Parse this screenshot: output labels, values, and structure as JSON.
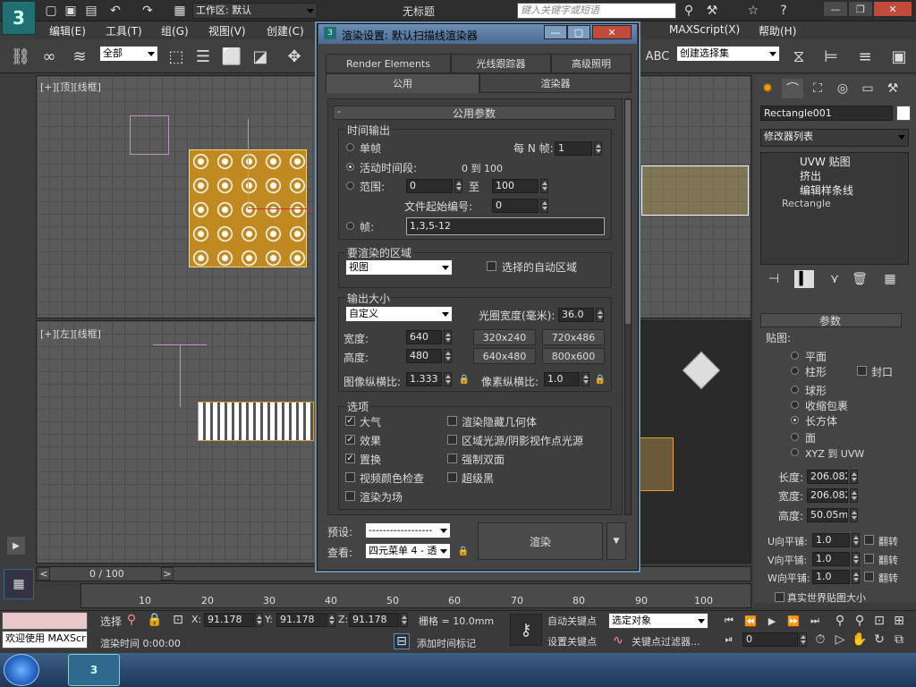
{
  "app": {
    "workspace": "工作区: 默认",
    "doc_title": "无标题",
    "search_placeholder": "键入关键字或短语"
  },
  "menu": [
    "编辑(E)",
    "工具(T)",
    "组(G)",
    "视图(V)",
    "创建(C)",
    "MAXScript(X)",
    "帮助(H)"
  ],
  "toolbar": {
    "filter": "全部",
    "named_selection": "创建选择集"
  },
  "viewports": {
    "top": "[+][顶][线框]",
    "left": "[+][左][线框]"
  },
  "dialog": {
    "title": "渲染设置: 默认扫描线渲染器",
    "tabs_row1": [
      "Render Elements",
      "光线跟踪器",
      "高级照明"
    ],
    "tabs_row2": [
      "公用",
      "渲染器"
    ],
    "rollout": "公用参数",
    "time_output": {
      "label": "时间输出",
      "single": "单帧",
      "every_n": "每 N 帧:",
      "every_n_val": "1",
      "active": "活动时间段:",
      "active_range": "0 到 100",
      "range": "范围:",
      "range_from": "0",
      "range_to_label": "至",
      "range_to": "100",
      "file_num": "文件起始编号:",
      "file_num_val": "0",
      "frames": "帧:",
      "frames_val": "1,3,5-12"
    },
    "area": {
      "label": "要渲染的区域",
      "value": "视图",
      "auto": "选择的自动区域"
    },
    "output": {
      "label": "输出大小",
      "preset": "自定义",
      "aperture": "光圈宽度(毫米):",
      "aperture_val": "36.0",
      "width": "宽度:",
      "width_val": "640",
      "height": "高度:",
      "height_val": "480",
      "sizes": [
        "320x240",
        "720x486",
        "640x480",
        "800x600"
      ],
      "image_aspect": "图像纵横比:",
      "image_aspect_val": "1.333",
      "pixel_aspect": "像素纵横比:",
      "pixel_aspect_val": "1.0"
    },
    "options": {
      "label": "选项",
      "items": [
        "大气",
        "渲染隐藏几何体",
        "效果",
        "区域光源/阴影视作点光源",
        "置换",
        "强制双面",
        "视频颜色检查",
        "超级黑",
        "渲染为场"
      ],
      "checked": [
        true,
        false,
        true,
        false,
        true,
        false,
        false,
        false,
        false
      ]
    },
    "bottom": {
      "preset_label": "预设:",
      "preset_val": "------------------",
      "view_label": "查看:",
      "view_val": "四元菜单 4 - 透",
      "render": "渲染"
    }
  },
  "cmd": {
    "object": "Rectangle001",
    "modlist": "修改器列表",
    "stack": [
      "UVW 贴图",
      "挤出",
      "编辑样条线",
      "Rectangle"
    ],
    "params": "参数",
    "map": "贴图:",
    "map_types": [
      "平面",
      "柱形",
      "封口",
      "球形",
      "收缩包裹",
      "长方体",
      "面",
      "XYZ 到 UVW"
    ],
    "length_lbl": "长度:",
    "length": "206.082",
    "width_lbl": "宽度:",
    "width": "206.082",
    "height_lbl": "高度:",
    "height": "50.05mm",
    "u_tile": "U向平铺:",
    "v_tile": "V向平铺:",
    "w_tile": "W向平铺:",
    "tile_val": "1.0",
    "flip": "翻转",
    "real_world": "真实世界贴图大小"
  },
  "timeline": {
    "frame": "0 / 100",
    "ticks": [
      "10",
      "20",
      "30",
      "40",
      "50",
      "60",
      "70",
      "80",
      "90",
      "100"
    ]
  },
  "status": {
    "welcome": "欢迎使用 MAXScr",
    "select": "选择",
    "x_lbl": "X:",
    "x": "91.178",
    "y_lbl": "Y:",
    "y": "91.178",
    "z_lbl": "Z:",
    "z": "91.178",
    "grid": "栅格 = 10.0mm",
    "autokey": "自动关键点",
    "setkey": "设置关键点",
    "selected": "选定对象",
    "key_filter": "关键点过滤器...",
    "render_time": "渲染时间 0:00:00",
    "add_time_tag": "添加时间标记",
    "frame_field": "0"
  }
}
